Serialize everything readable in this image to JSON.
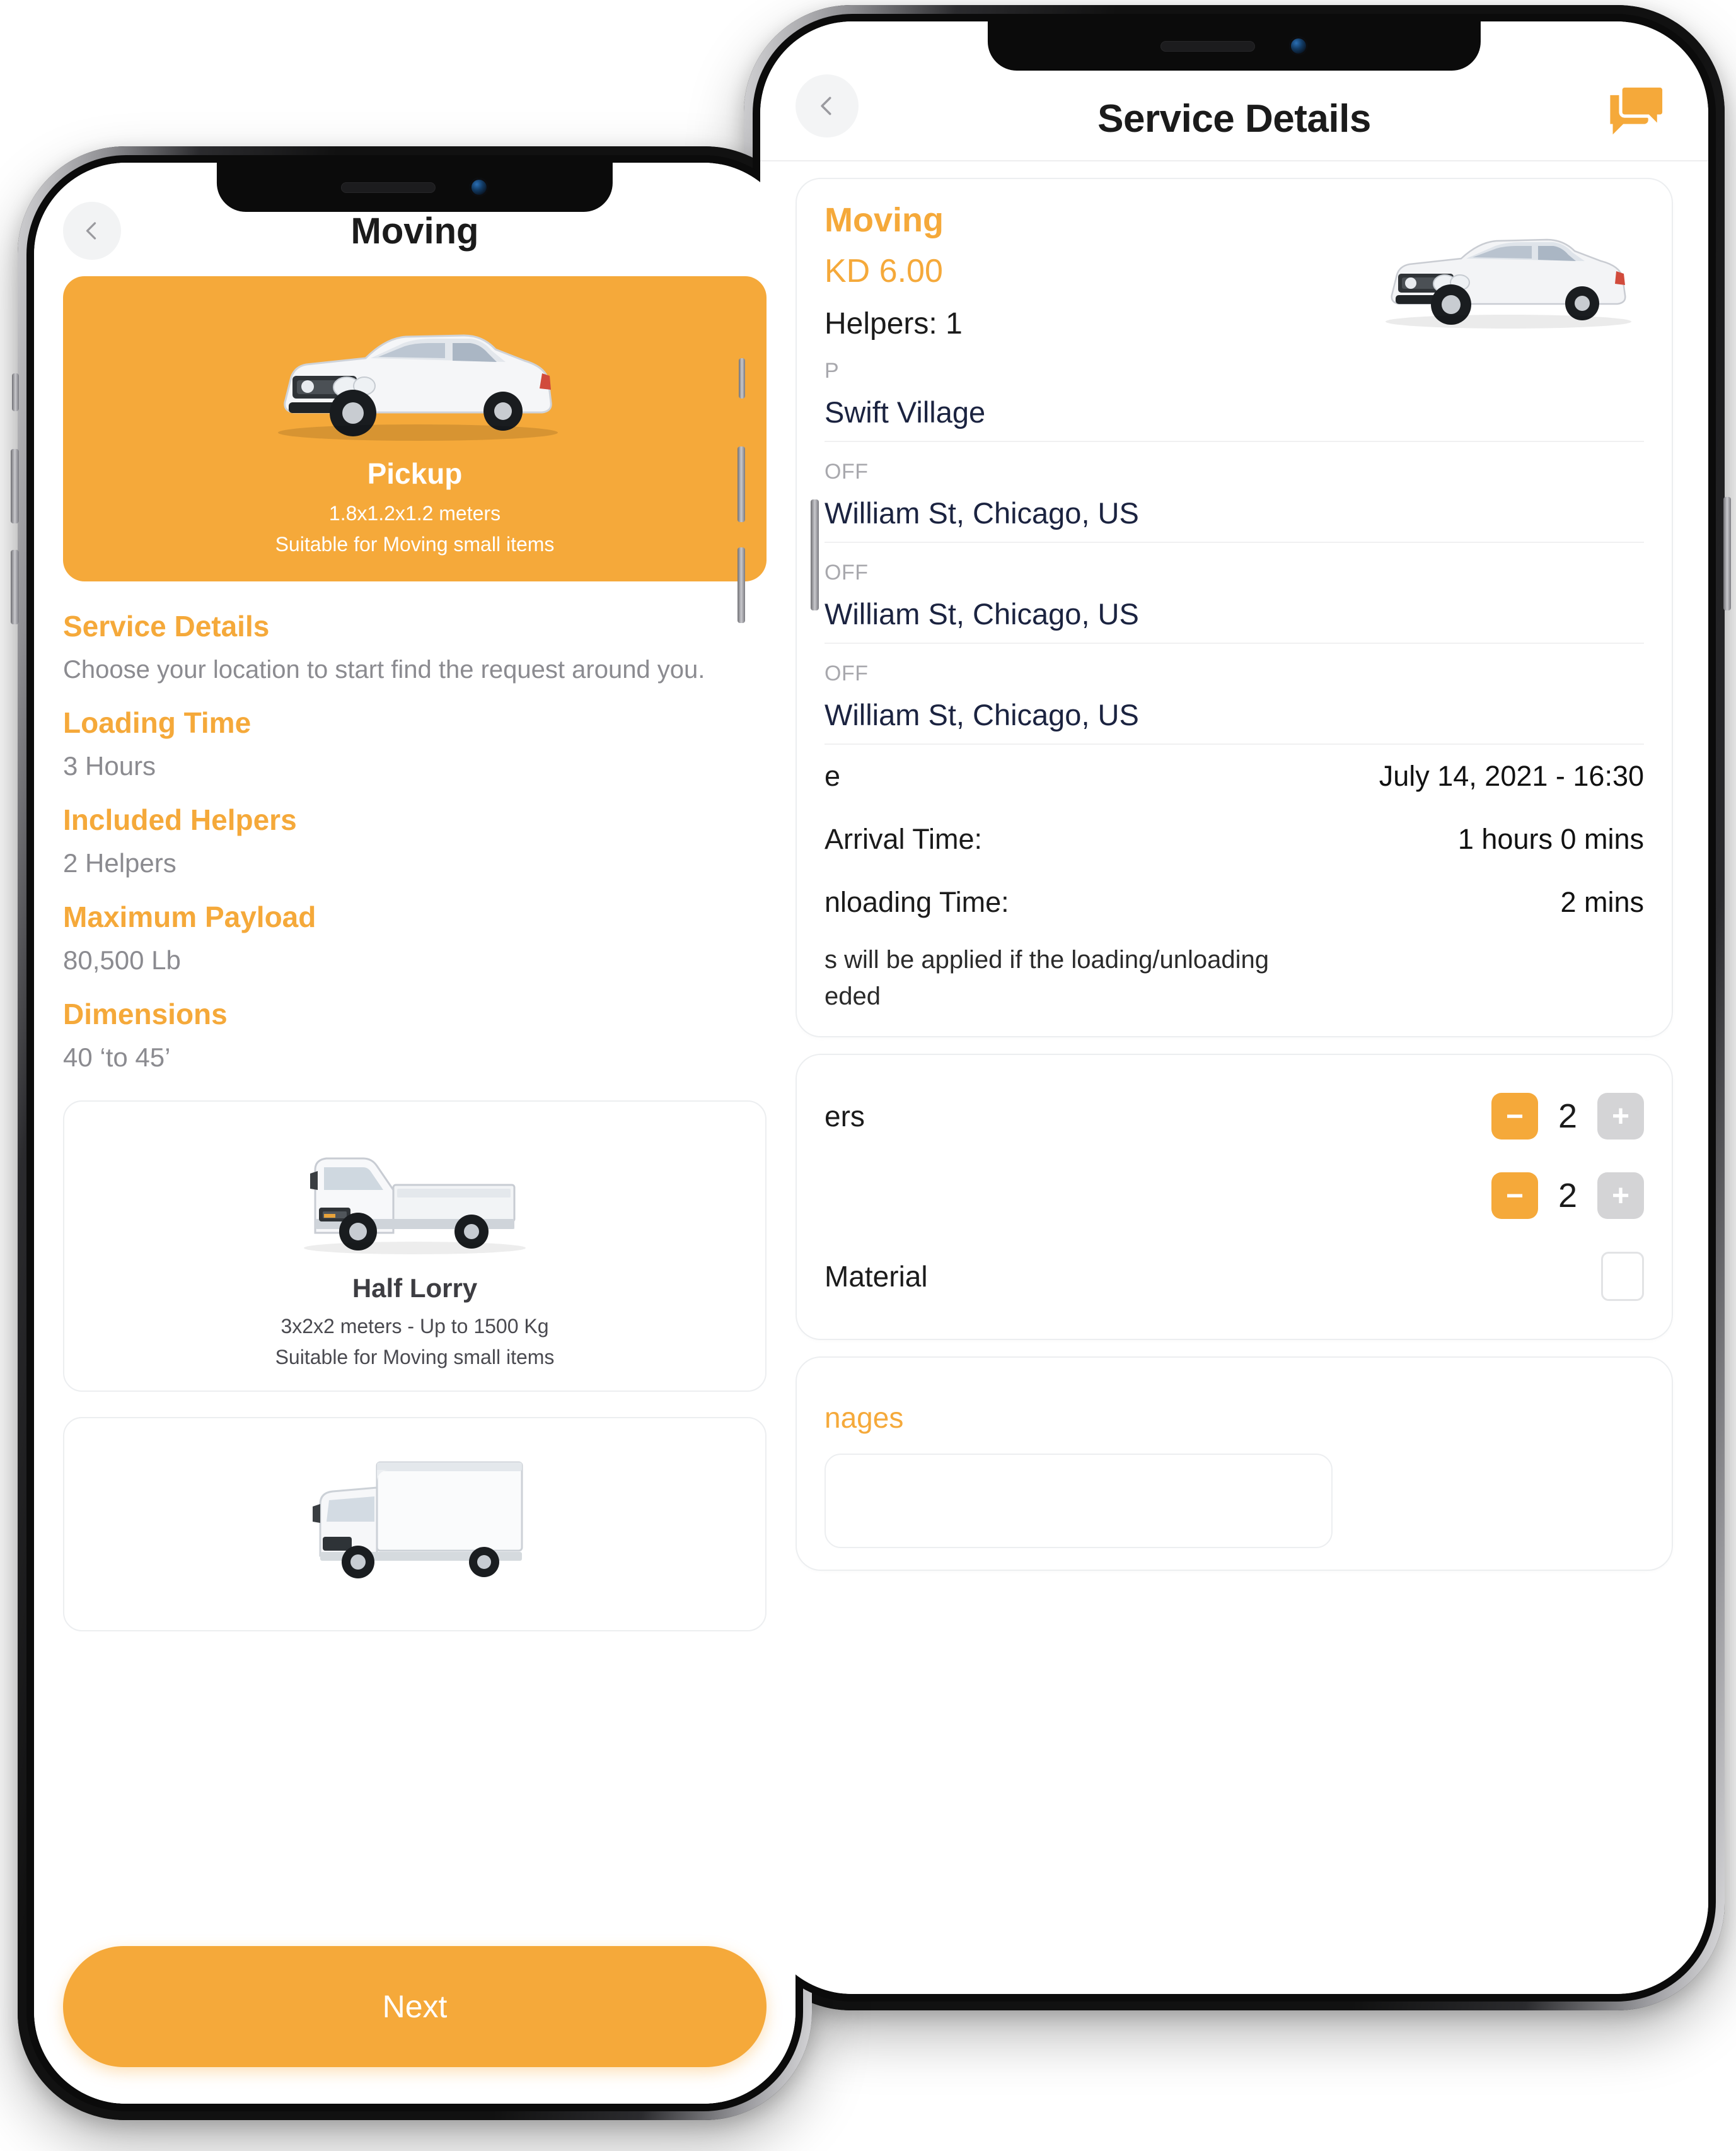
{
  "back_phone": {
    "header": {
      "title": "Service Details",
      "back_icon": "chevron-left-icon",
      "chat_icon": "chat-bubbles-icon"
    },
    "service": {
      "name": "Moving",
      "price": "KD 6.00",
      "helpers": "Helpers: 1",
      "vehicle_icon": "pickup-truck-image"
    },
    "addresses": [
      {
        "label": "P",
        "value": "Swift Village"
      },
      {
        "label": "OFF",
        "value": "William St, Chicago, US"
      },
      {
        "label": "OFF",
        "value": "William St, Chicago, US"
      },
      {
        "label": "OFF",
        "value": "William St, Chicago, US"
      }
    ],
    "schedule": [
      {
        "key": "e",
        "value": "July 14, 2021 - 16:30"
      },
      {
        "key": "Arrival Time:",
        "value": "1 hours 0 mins"
      },
      {
        "key": "nloading Time:",
        "value": "2 mins"
      }
    ],
    "note": "s will be applied if the loading/unloading\neded",
    "options": [
      {
        "label": "ers",
        "type": "stepper",
        "value": "2",
        "minus": "−",
        "plus": "+"
      },
      {
        "label": "",
        "type": "stepper",
        "value": "2",
        "minus": "−",
        "plus": "+"
      },
      {
        "label": "Material",
        "type": "checkbox",
        "checked": false
      }
    ],
    "link": "nages"
  },
  "front_phone": {
    "header": {
      "title": "Moving",
      "back_icon": "chevron-left-icon"
    },
    "hero": {
      "name": "Pickup",
      "dimensions": "1.8x1.2x1.2 meters",
      "subtitle": "Suitable for Moving small items",
      "vehicle_icon": "pickup-truck-image",
      "bg_color": "#F5A93A"
    },
    "section": {
      "title": "Service Details",
      "description": "Choose your location to start find the request around you."
    },
    "fields": [
      {
        "label": "Loading Time",
        "value": "3 Hours"
      },
      {
        "label": "Included Helpers",
        "value": "2 Helpers"
      },
      {
        "label": "Maximum Payload",
        "value": "80,500 Lb"
      },
      {
        "label": "Dimensions",
        "value": "40 ‘to 45’"
      }
    ],
    "vehicle_cards": [
      {
        "name": "Half Lorry",
        "dimensions": "3x2x2 meters - Up to 1500 Kg",
        "subtitle": "Suitable for Moving small items",
        "vehicle_icon": "flatbed-lorry-image"
      }
    ],
    "partial_card": {
      "vehicle_icon": "box-truck-image"
    },
    "next_button": "Next"
  },
  "colors": {
    "accent": "#F5A93A",
    "text_dark": "#1B1B1B",
    "text_muted": "#8B8B90",
    "address_text": "#1B2340",
    "divider": "#EEEEEF"
  }
}
